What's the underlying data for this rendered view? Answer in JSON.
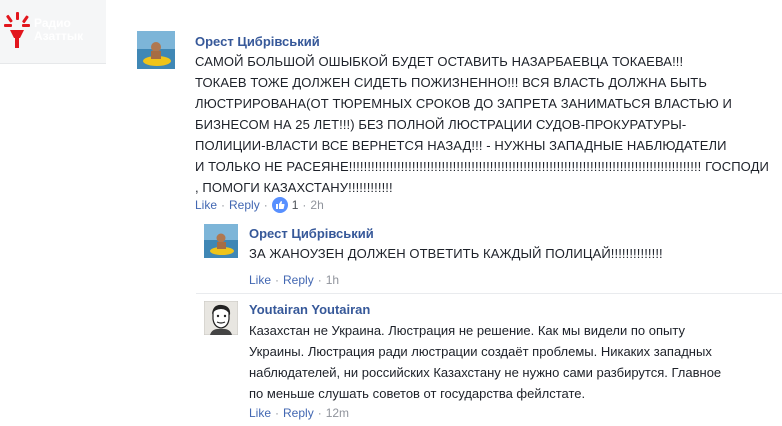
{
  "brand": {
    "line1": "Радио",
    "line2": "Азаттык",
    "accent": "#e2161d"
  },
  "comments": [
    {
      "author": "Орест Цибрівський",
      "lines": [
        "САМОЙ БОЛЬШОЙ ОШЫБКОЙ БУДЕТ ОСТАВИТЬ НАЗАРБАЕВЦА ТОКАЕВА!!!",
        "ТОКАЕВ ТОЖЕ ДОЛЖЕН СИДЕТЬ ПОЖИЗНЕННО!!! ВСЯ ВЛАСТЬ ДОЛЖНА БЫТЬ",
        "ЛЮСТРИРОВАНА(ОТ ТЮРЕМНЫХ СРОКОВ ДО ЗАПРЕТА ЗАНИМАТЬСЯ ВЛАСТЬЮ И",
        "БИЗНЕСОМ НА 25 ЛЕТ!!!) БЕЗ ПОЛНОЙ ЛЮСТРАЦИИ СУДОВ-ПРОКУРАТУРЫ-",
        "ПОЛИЦИИ-ВЛАСТИ ВСЕ ВЕРНЕТСЯ НАЗАД!!! - НУЖНЫ ЗАПАДНЫЕ НАБЛЮДАТЕЛИ",
        "И ТОЛЬКО НЕ РАСЕЯНЕ!!!!!!!!!!!!!!!!!!!!!!!!!!!!!!!!!!!!!!!!!!!!!!!!!!!!!!!!!!!!!!!!!!!!!!!!!!!!!!!!!!!!!!!!!!!!!!! ГОСПОДИ",
        ", ПОМОГИ КАЗАХСТАНУ!!!!!!!!!!!!"
      ],
      "like_label": "Like",
      "reply_label": "Reply",
      "like_count": "1",
      "time": "2h"
    },
    {
      "author": "Орест Цибрівський",
      "lines": [
        "ЗА ЖАНОУЗЕН ДОЛЖЕН ОТВЕТИТЬ КАЖДЫЙ ПОЛИЦАЙ!!!!!!!!!!!!!!"
      ],
      "like_label": "Like",
      "reply_label": "Reply",
      "time": "1h"
    },
    {
      "author": "Youtairan Youtairan",
      "lines": [
        "Казахстан не Украина. Люстрация не решение. Как мы видели по опыту",
        "Украины. Люстрация ради люстрации создаёт проблемы. Никаких западных",
        "наблюдателей, ни российских Казахстану не нужно сами разбирутся. Главное",
        "по меньше слушать советов от государства фейлстате."
      ],
      "like_label": "Like",
      "reply_label": "Reply",
      "time": "12m"
    }
  ],
  "colors": {
    "link": "#365899",
    "action": "#4267b2",
    "muted": "#90949c",
    "like_badge": "#5890ff"
  }
}
